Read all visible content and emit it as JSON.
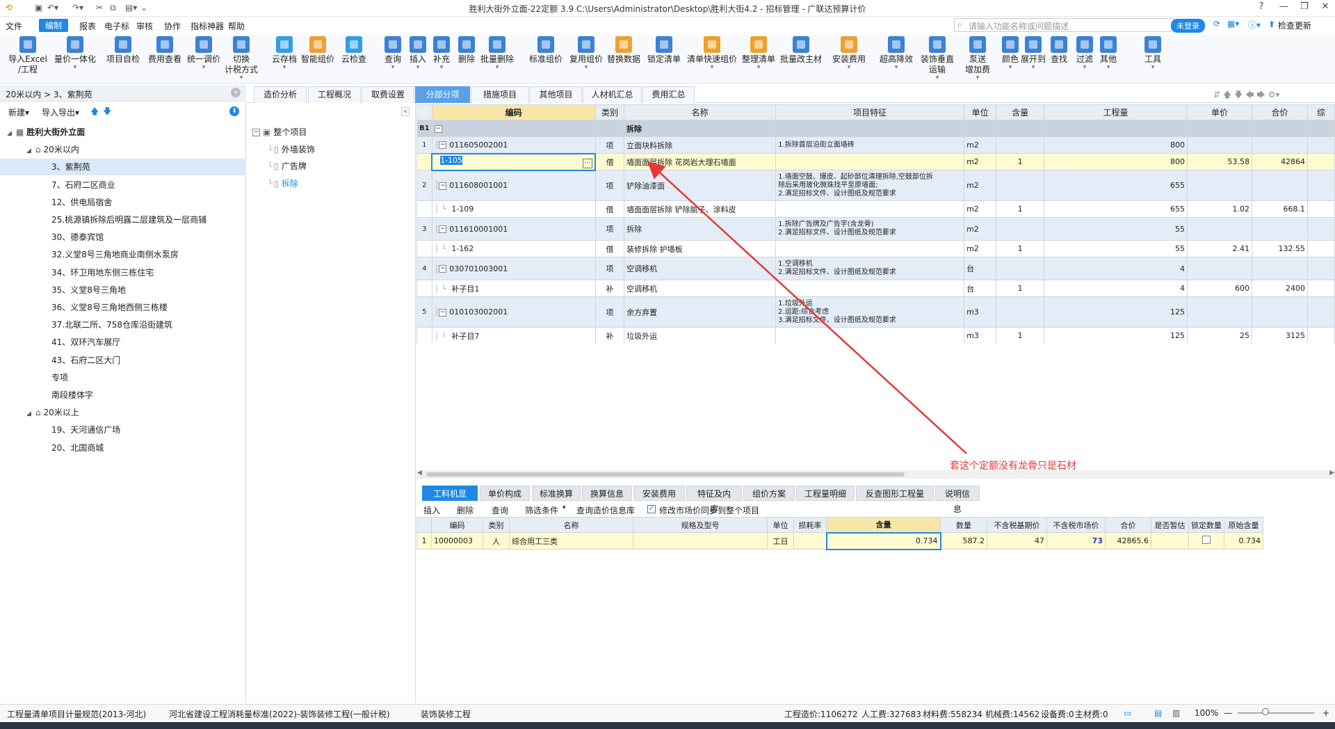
{
  "window": {
    "title": "胜利大街外立面-22定额 3.9  C:\\Users\\Administrator\\Desktop\\胜利大街4.2 - 招标管理 - 广联达预算计价"
  },
  "menu": [
    "文件",
    "编制",
    "报表",
    "电子标",
    "审核",
    "协作",
    "指标神器",
    "帮助"
  ],
  "menu_active": "编制",
  "search": {
    "placeholder": "请输入功能名称或问题描述"
  },
  "login_label": "未登录",
  "update_label": "检查更新",
  "toolbar": [
    {
      "label": "导入Excel\n/工程",
      "color": "#3b82d6"
    },
    {
      "label": "量价一体化",
      "color": "#3b82d6"
    },
    {
      "label": "项目自检",
      "color": "#3b82d6"
    },
    {
      "label": "费用查看",
      "color": "#3b82d6"
    },
    {
      "label": "统一调价",
      "color": "#3b82d6"
    },
    {
      "label": "切换\n计税方式",
      "color": "#3b82d6"
    },
    {
      "label": "云存档",
      "color": "#2f9ee8"
    },
    {
      "label": "智能组价",
      "color": "#f0a030"
    },
    {
      "label": "云检查",
      "color": "#2f9ee8"
    },
    {
      "label": "查询",
      "color": "#3b82d6"
    },
    {
      "label": "插入",
      "color": "#3b82d6"
    },
    {
      "label": "补充",
      "color": "#3b82d6"
    },
    {
      "label": "删除",
      "color": "#3b82d6"
    },
    {
      "label": "批量删除",
      "color": "#3b82d6"
    },
    {
      "label": "标准组价",
      "color": "#3b82d6"
    },
    {
      "label": "复用组价",
      "color": "#3b82d6"
    },
    {
      "label": "替换数据",
      "color": "#f0a030"
    },
    {
      "label": "锁定清单",
      "color": "#3b82d6"
    },
    {
      "label": "清单快速组价",
      "color": "#f0a030"
    },
    {
      "label": "整理清单",
      "color": "#f0a030"
    },
    {
      "label": "批量改主材",
      "color": "#3b82d6"
    },
    {
      "label": "安装费用",
      "color": "#f0a030"
    },
    {
      "label": "超高降效",
      "color": "#3b82d6"
    },
    {
      "label": "装饰垂直\n运输",
      "color": "#3b82d6"
    },
    {
      "label": "泵送\n增加费",
      "color": "#3b82d6"
    },
    {
      "label": "颜色",
      "color": "#3b82d6"
    },
    {
      "label": "展开到",
      "color": "#3b82d6"
    },
    {
      "label": "查找",
      "color": "#3b82d6"
    },
    {
      "label": "过滤",
      "color": "#3b82d6"
    },
    {
      "label": "其他",
      "color": "#3b82d6"
    },
    {
      "label": "工具",
      "color": "#3b82d6"
    }
  ],
  "left": {
    "breadcrumb": "20米以内 > 3、紫荆苑",
    "new_label": "新建",
    "import_label": "导入导出",
    "tree": [
      {
        "label": "胜利大街外立面",
        "level": 0,
        "bold": true
      },
      {
        "label": "20米以内",
        "level": 1
      },
      {
        "label": "3、紫荆苑",
        "level": 2,
        "selected": true
      },
      {
        "label": "7、石府二区商业",
        "level": 2
      },
      {
        "label": "12、供电局宿舍",
        "level": 2
      },
      {
        "label": "25.桃源镇拆除后明露二层建筑及一层商铺",
        "level": 2
      },
      {
        "label": "30、德泰宾馆",
        "level": 2
      },
      {
        "label": "32.义堂8号三角地商业南侧水泵房",
        "level": 2
      },
      {
        "label": "34、环卫用地东侧三栋住宅",
        "level": 2
      },
      {
        "label": "35、义堂8号三角地",
        "level": 2
      },
      {
        "label": "36、义堂8号三角地西侧三栋楼",
        "level": 2
      },
      {
        "label": "37.北联二所、758仓库沿街建筑",
        "level": 2
      },
      {
        "label": "41、双环汽车展厅",
        "level": 2
      },
      {
        "label": "43、石府二区大门",
        "level": 2
      },
      {
        "label": "专项",
        "level": 2
      },
      {
        "label": "南段楼体字",
        "level": 2
      },
      {
        "label": "20米以上",
        "level": 1
      },
      {
        "label": "19、天河通信广场",
        "level": 2
      },
      {
        "label": "20、北国商城",
        "level": 2
      }
    ]
  },
  "mid_tree": [
    {
      "label": "整个项目",
      "level": 0
    },
    {
      "label": "外墙装饰",
      "level": 1
    },
    {
      "label": "广告牌",
      "level": 1
    },
    {
      "label": "拆除",
      "level": 1,
      "active": true
    }
  ],
  "tabs": [
    "造价分析",
    "工程概况",
    "取费设置",
    "分部分项",
    "措施项目",
    "其他项目",
    "人材机汇总",
    "费用汇总"
  ],
  "tab_active": "分部分项",
  "grid": {
    "headers": [
      "编码",
      "类别",
      "名称",
      "项目特征",
      "单位",
      "含量",
      "工程量",
      "单价",
      "合价",
      "综"
    ],
    "b1": {
      "label": "B1",
      "name": "拆除"
    },
    "rows": [
      {
        "idx": "1",
        "code": "011605002001",
        "type": "项",
        "name": "立面块料拆除",
        "feature": "1.拆除首层沿街立面墙砖",
        "unit": "m2",
        "content": "",
        "qty": "800",
        "price": "",
        "total": "",
        "kind": "main"
      },
      {
        "idx": "",
        "code": "1-105",
        "type": "借",
        "name": "墙面面层拆除 花岗岩大理石墙面",
        "feature": "",
        "unit": "m2",
        "content": "1",
        "qty": "800",
        "price": "53.58",
        "total": "42864",
        "kind": "active"
      },
      {
        "idx": "2",
        "code": "011608001001",
        "type": "项",
        "name": "铲除油漆面",
        "feature": "1.墙面空鼓、爆皮、起砂部位清理拆除,空鼓部位拆\n除后采用玻化微珠找平至原墙面;\n2.满足招标文件、设计图纸及规范要求",
        "unit": "m2",
        "content": "",
        "qty": "655",
        "price": "",
        "total": "",
        "kind": "main3"
      },
      {
        "idx": "",
        "code": "1-109",
        "type": "借",
        "name": "墙面面层拆除 铲除腻子、涂料皮",
        "feature": "",
        "unit": "m2",
        "content": "1",
        "qty": "655",
        "price": "1.02",
        "total": "668.1",
        "kind": "sub"
      },
      {
        "idx": "3",
        "code": "011610001001",
        "type": "项",
        "name": "拆除",
        "feature": "1.拆除广告牌及广告字(含龙骨)\n2.满足招标文件、设计图纸及规范要求",
        "unit": "m2",
        "content": "",
        "qty": "55",
        "price": "",
        "total": "",
        "kind": "main2"
      },
      {
        "idx": "",
        "code": "1-162",
        "type": "借",
        "name": "装修拆除 护墙板",
        "feature": "",
        "unit": "m2",
        "content": "1",
        "qty": "55",
        "price": "2.41",
        "total": "132.55",
        "kind": "sub"
      },
      {
        "idx": "4",
        "code": "030701003001",
        "type": "项",
        "name": "空调移机",
        "feature": "1.空调移机\n2.满足招标文件、设计图纸及规范要求",
        "unit": "台",
        "content": "",
        "qty": "4",
        "price": "",
        "total": "",
        "kind": "main2"
      },
      {
        "idx": "",
        "code": "补子目1",
        "type": "补",
        "name": "空调移机",
        "feature": "",
        "unit": "台",
        "content": "1",
        "qty": "4",
        "price": "600",
        "total": "2400",
        "kind": "sub"
      },
      {
        "idx": "5",
        "code": "010103002001",
        "type": "项",
        "name": "余方弃置",
        "feature": "1.垃圾外运\n2.运距:综合考虑\n3.满足招标文件、设计图纸及规范要求",
        "unit": "m3",
        "content": "",
        "qty": "125",
        "price": "",
        "total": "",
        "kind": "main3"
      },
      {
        "idx": "",
        "code": "补子目7",
        "type": "补",
        "name": "垃圾外运",
        "feature": "",
        "unit": "m3",
        "content": "1",
        "qty": "125",
        "price": "25",
        "total": "3125",
        "kind": "sub"
      }
    ]
  },
  "annotation": "套这个定额没有龙骨只是石材",
  "bottom_tabs": [
    "工料机显示",
    "单价构成",
    "标准换算",
    "换算信息",
    "安装费用",
    "特征及内容",
    "组价方案",
    "工程量明细",
    "反查图形工程量",
    "说明信息"
  ],
  "bottom_tab_active": "工料机显示",
  "bottom_toolbar": [
    "插入",
    "删除",
    "查询",
    "筛选条件",
    "查询造价信息库"
  ],
  "sync_label": "修改市场价同步到整个项目",
  "btable": {
    "headers": [
      "编码",
      "类别",
      "名称",
      "规格及型号",
      "单位",
      "损耗率",
      "含量",
      "数量",
      "不含税基期价",
      "不含税市场价",
      "合价",
      "是否暂估",
      "锁定数量",
      "原始含量"
    ],
    "row": {
      "idx": "1",
      "code": "10000003",
      "type": "人",
      "name": "综合用工三类",
      "spec": "",
      "unit": "工日",
      "loss": "",
      "content": "0.734",
      "qty": "587.2",
      "base": "47",
      "market": "73",
      "total": "42865.6",
      "est": "",
      "lock": "",
      "orig": "0.734"
    }
  },
  "status": {
    "s1": "工程量清单项目计量规范(2013-河北)",
    "s2": "河北省建设工程消耗量标准(2022)-装饰装修工程(一般计税)",
    "s3": "装饰装修工程",
    "s4": "工程造价:1106272",
    "s5": "人工费:327683",
    "s6": "材料费:558234",
    "s7": "机械费:14562",
    "s8": "设备费:0",
    "s9": "主材费:0",
    "zoom": "100%"
  }
}
